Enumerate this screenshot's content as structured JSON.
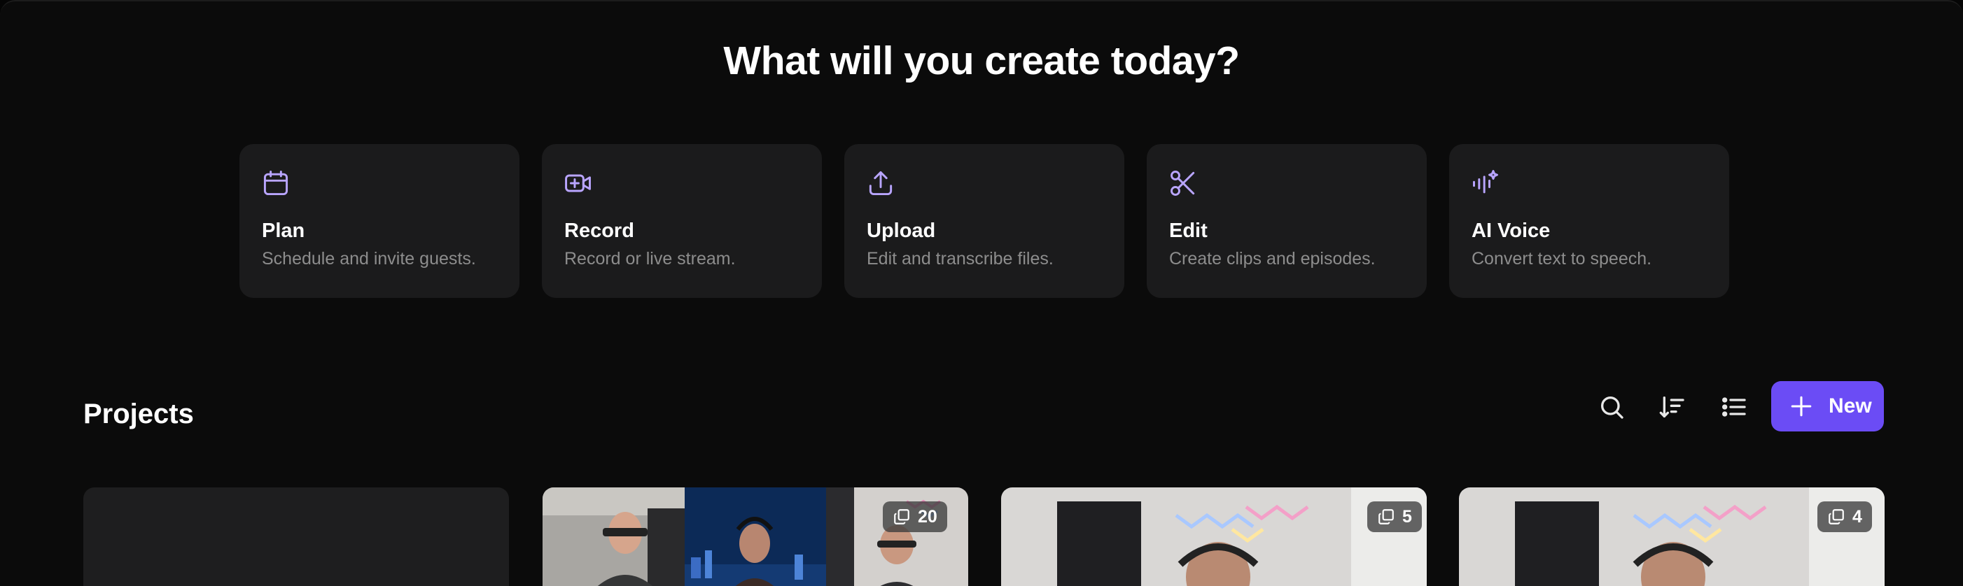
{
  "headline": "What will you create today?",
  "actions": [
    {
      "title": "Plan",
      "subtitle": "Schedule and invite guests.",
      "icon": "calendar-icon"
    },
    {
      "title": "Record",
      "subtitle": "Record or live stream.",
      "icon": "video-plus-icon"
    },
    {
      "title": "Upload",
      "subtitle": "Edit and transcribe files.",
      "icon": "upload-icon"
    },
    {
      "title": "Edit",
      "subtitle": "Create clips and episodes.",
      "icon": "scissors-icon"
    },
    {
      "title": "AI Voice",
      "subtitle": "Convert text to speech.",
      "icon": "ai-waveform-icon"
    }
  ],
  "projects": {
    "title": "Projects",
    "toolbar": {
      "search_icon": "search-icon",
      "sort_icon": "sort-icon",
      "view_icon": "list-view-icon"
    },
    "new_button_label": "New",
    "tiles": [
      {
        "count": null
      },
      {
        "count": "20"
      },
      {
        "count": "5"
      },
      {
        "count": "4"
      }
    ]
  },
  "colors": {
    "accent": "#6b4cf5",
    "icon_accent": "#b9a5ff",
    "card_bg": "#1b1b1c",
    "page_bg": "#0b0b0b"
  }
}
